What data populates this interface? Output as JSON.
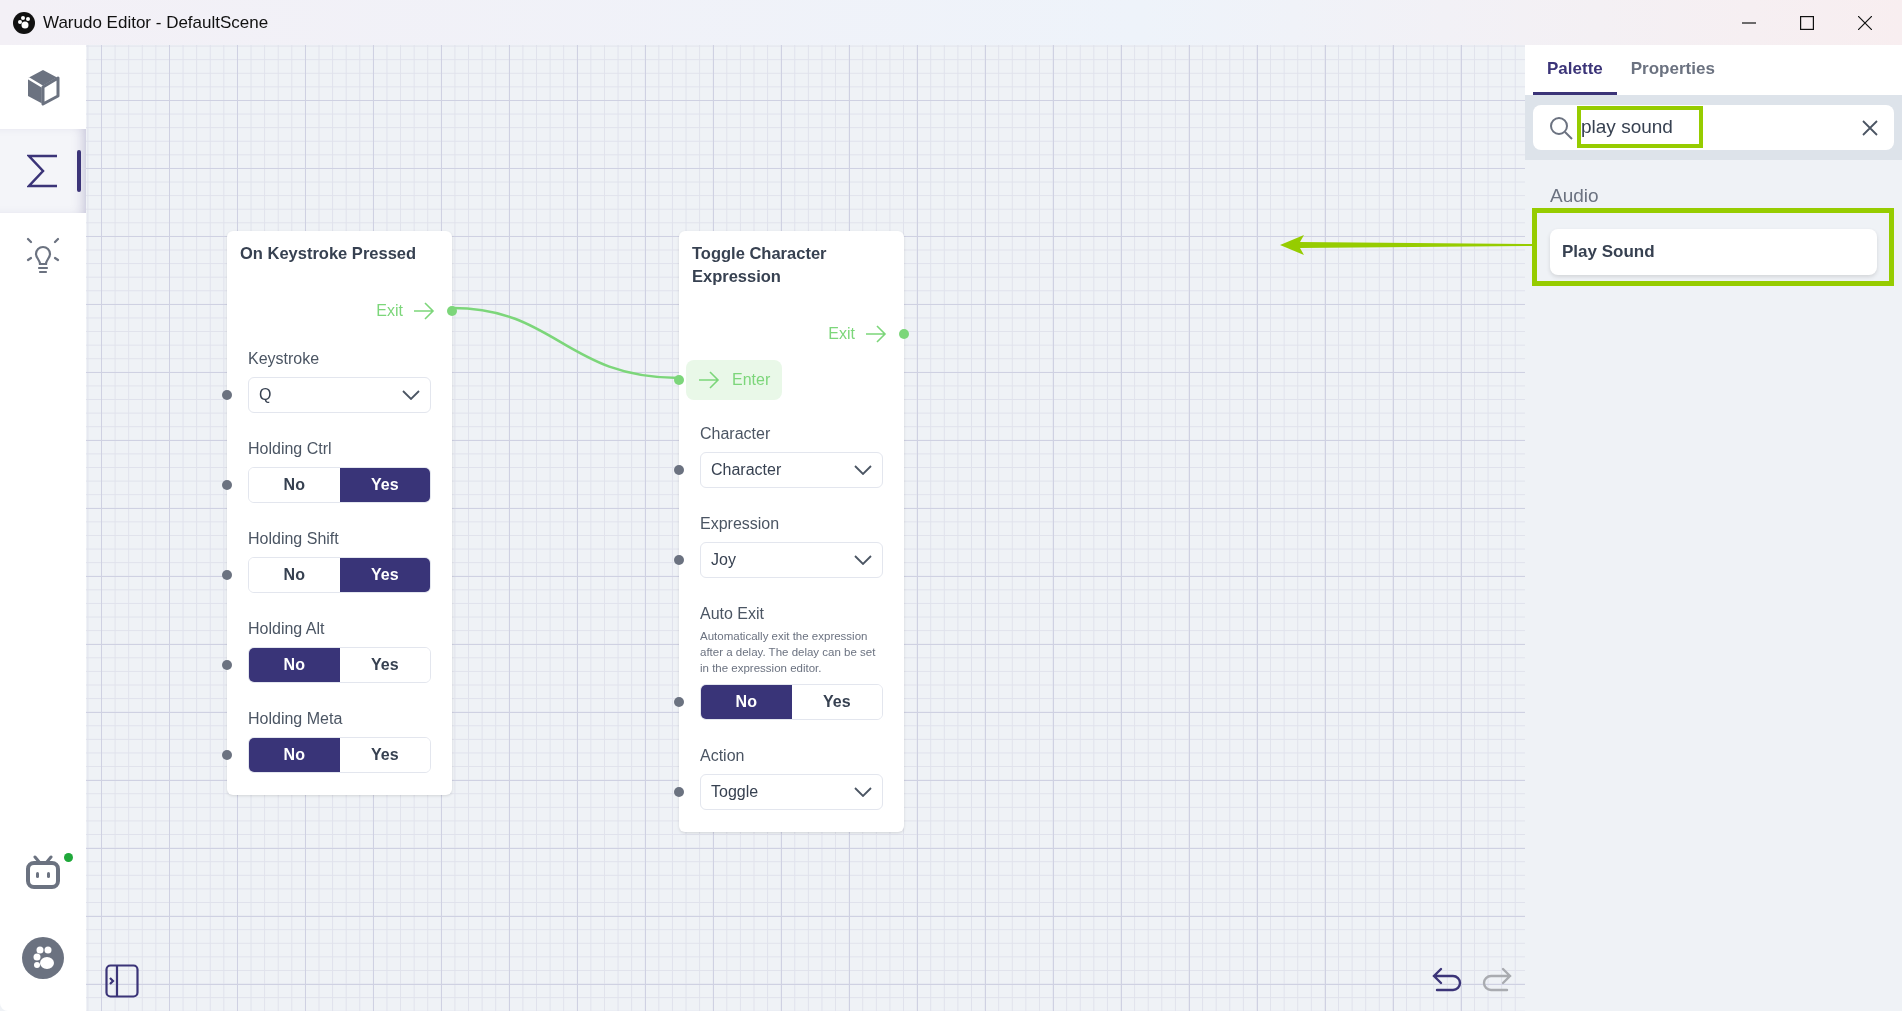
{
  "window": {
    "title": "Warudo Editor - DefaultScene"
  },
  "sidebar": {
    "items": [
      {
        "kind": "cube",
        "selected": false
      },
      {
        "kind": "sigma",
        "selected": true
      },
      {
        "kind": "bulb",
        "selected": false
      }
    ],
    "bottom_items": [
      {
        "kind": "robot",
        "online": true
      },
      {
        "kind": "logo",
        "online": false
      }
    ]
  },
  "nodes": [
    {
      "title": "On Keystroke Pressed",
      "outputs": [
        {
          "label": "Exit"
        }
      ],
      "fields": [
        {
          "kind": "dropdown",
          "label": "Keystroke",
          "value": "Q"
        },
        {
          "kind": "toggle",
          "label": "Holding Ctrl",
          "options": [
            {
              "label": "No",
              "selected": false
            },
            {
              "label": "Yes",
              "selected": true
            }
          ]
        },
        {
          "kind": "toggle",
          "label": "Holding Shift",
          "options": [
            {
              "label": "No",
              "selected": false
            },
            {
              "label": "Yes",
              "selected": true
            }
          ]
        },
        {
          "kind": "toggle",
          "label": "Holding Alt",
          "options": [
            {
              "label": "No",
              "selected": true
            },
            {
              "label": "Yes",
              "selected": false
            }
          ]
        },
        {
          "kind": "toggle",
          "label": "Holding Meta",
          "options": [
            {
              "label": "No",
              "selected": true
            },
            {
              "label": "Yes",
              "selected": false
            }
          ]
        }
      ]
    },
    {
      "title": "Toggle Character Expression",
      "outputs": [
        {
          "label": "Exit"
        }
      ],
      "inputs": [
        {
          "label": "Enter"
        }
      ],
      "fields": [
        {
          "kind": "dropdown",
          "label": "Character",
          "value": "Character"
        },
        {
          "kind": "dropdown",
          "label": "Expression",
          "value": "Joy"
        },
        {
          "kind": "toggle",
          "label": "Auto Exit",
          "description": "Automatically exit the expression after a delay. The delay can be set in the expression editor.",
          "options": [
            {
              "label": "No",
              "selected": true
            },
            {
              "label": "Yes",
              "selected": false
            }
          ]
        },
        {
          "kind": "dropdown",
          "label": "Action",
          "value": "Toggle"
        }
      ]
    }
  ],
  "panel": {
    "tabs": [
      {
        "label": "Palette",
        "selected": true
      },
      {
        "label": "Properties",
        "selected": false
      }
    ],
    "search": {
      "value": "play sound"
    },
    "groups": [
      {
        "title": "Audio",
        "items": [
          {
            "label": "Play Sound"
          }
        ]
      }
    ]
  }
}
